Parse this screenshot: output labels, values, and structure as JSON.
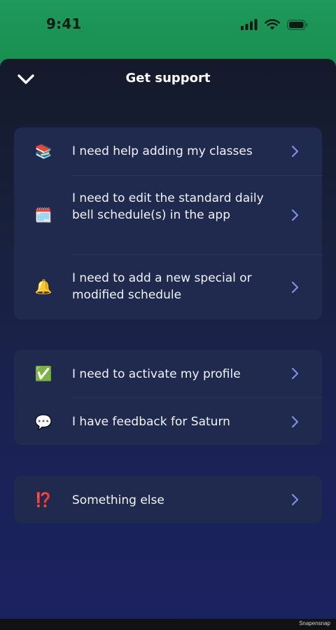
{
  "status_bar": {
    "time": "9:41",
    "icons": [
      "cellular-signal-icon",
      "wifi-icon",
      "battery-icon"
    ],
    "background": "#1e9a5c"
  },
  "header": {
    "title": "Get support",
    "back_icon": "chevron-down-icon"
  },
  "groups": [
    {
      "items": [
        {
          "emoji": "📚",
          "icon": "books-icon",
          "label": "I need help adding my classes"
        },
        {
          "emoji": "🗓️",
          "icon": "calendar-icon",
          "label": "I need to edit the standard daily bell schedule(s) in the app"
        },
        {
          "emoji": "🔔",
          "icon": "bell-icon",
          "label": "I need to add a new special or modified schedule"
        }
      ]
    },
    {
      "items": [
        {
          "emoji": "✅",
          "icon": "check-mark-icon",
          "label": "I need to activate my profile"
        },
        {
          "emoji": "💬",
          "icon": "speech-bubble-icon",
          "label": "I have feedback for Saturn"
        }
      ]
    },
    {
      "items": [
        {
          "emoji": "⁉️",
          "icon": "exclamation-question-icon",
          "label": "Something else"
        }
      ]
    }
  ],
  "colors": {
    "accent_chevron": "#7f8fe6",
    "card_background": "#1f2a4e",
    "text": "#f2f4fa"
  },
  "watermark": "Snapensnap"
}
